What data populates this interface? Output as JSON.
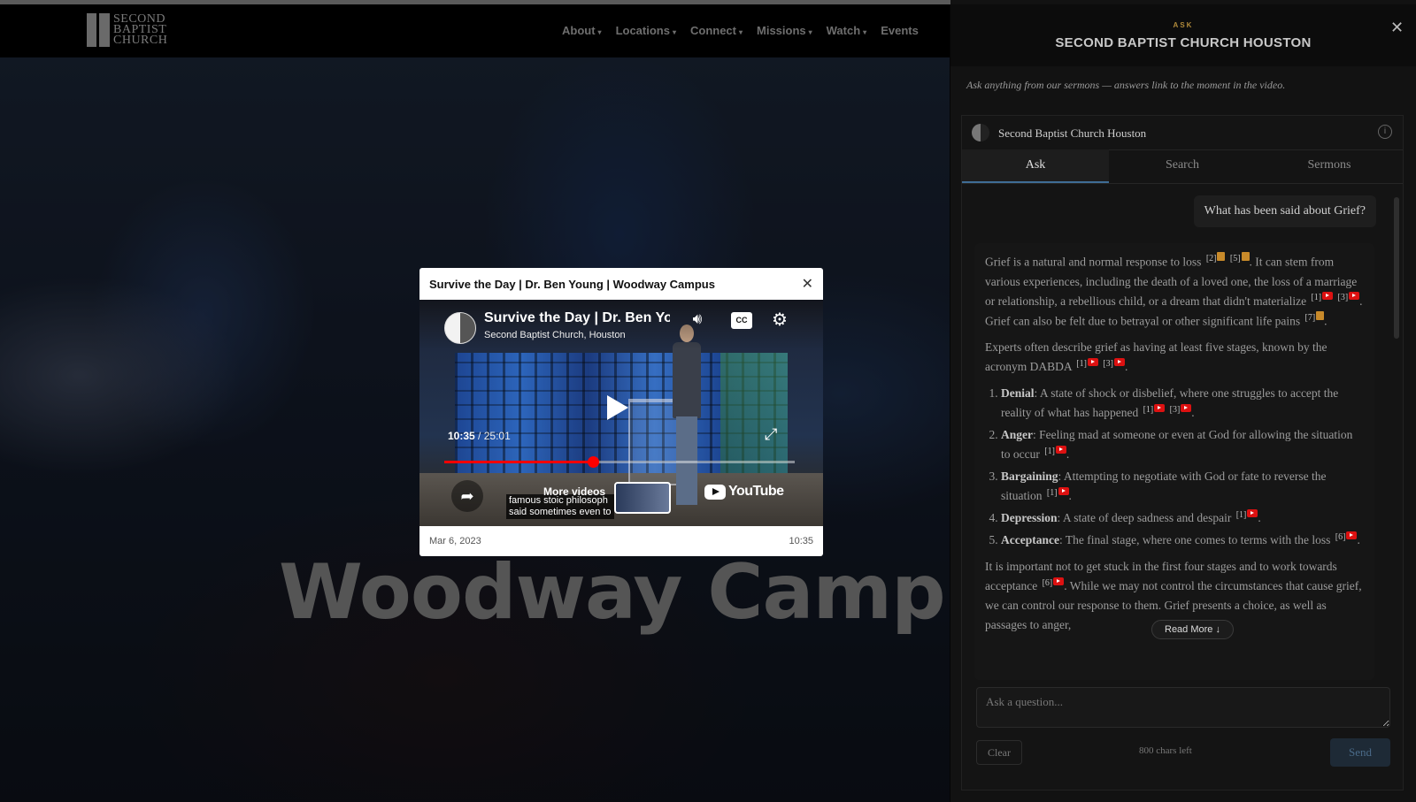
{
  "site": {
    "logo_lines": [
      "SECOND",
      "BAPTIST",
      "CHURCH"
    ],
    "nav": [
      "About",
      "Locations",
      "Connect",
      "Missions",
      "Watch",
      "Events"
    ],
    "hero_title": "Woodway Campus"
  },
  "modal": {
    "title": "Survive the Day | Dr. Ben Young | Woodway Campus",
    "close": "✕",
    "video": {
      "title": "Survive the Day | Dr. Ben Yo",
      "channel": "Second Baptist Church, Houston",
      "current_time": "10:35",
      "separator": "/",
      "duration": "25:01",
      "progress_fraction": 0.423,
      "more_videos": "More videos",
      "caption": "famous stoic philosoph\nsaid sometimes even to",
      "youtube_label": "YouTube"
    },
    "date": "Mar 6, 2023",
    "timestamp": "10:35"
  },
  "panel": {
    "kicker": "ASK",
    "title": "SECOND BAPTIST CHURCH HOUSTON",
    "close": "✕",
    "subtitle": "Ask anything from our sermons — answers link to the moment in the video.",
    "brand": "Second Baptist Church Houston",
    "info": "i",
    "tabs": [
      "Ask",
      "Search",
      "Sermons"
    ],
    "active_tab": "Ask",
    "question": "What has been said about Grief?",
    "answer": {
      "p1": [
        "Grief is a natural and normal response to loss",
        ". It can stem from various experiences, including the death of a loved one, the loss of a marriage or relationship, a rebellious child, or a dream that didn't materialize",
        ". Grief can also be felt due to betrayal or other significant life pains",
        "."
      ],
      "p2": [
        "Experts often describe grief as having at least five stages, known by the acronym DABDA",
        "."
      ],
      "stages": [
        {
          "name": "Denial",
          "text": ": A state of shock or disbelief, where one struggles to accept the reality of what has happened"
        },
        {
          "name": "Anger",
          "text": ": Feeling mad at someone or even at God for allowing the situation to occur"
        },
        {
          "name": "Bargaining",
          "text": ": Attempting to negotiate with God or fate to reverse the situation"
        },
        {
          "name": "Depression",
          "text": ": A state of deep sadness and despair"
        },
        {
          "name": "Acceptance",
          "text": ": The final stage, where one comes to terms with the loss"
        }
      ],
      "p3": [
        "It is important not to get stuck in the first four stages and to work towards acceptance",
        ". While we may not control the circumstances that cause grief, we can control our response to them. Grief presents a choice, as well as passages to anger,"
      ],
      "citations": {
        "c2": "[2]",
        "c5": "[5]",
        "c1": "[1]",
        "c3": "[3]",
        "c7": "[7]",
        "c6": "[6]"
      }
    },
    "read_more": "Read More ↓",
    "input_placeholder": "Ask a question...",
    "clear": "Clear",
    "chars_left": "800 chars left",
    "send": "Send"
  },
  "colors": {
    "accent": "#b08a3a",
    "youtube_red": "#ff0000",
    "tab_underline": "#3f6d95"
  }
}
